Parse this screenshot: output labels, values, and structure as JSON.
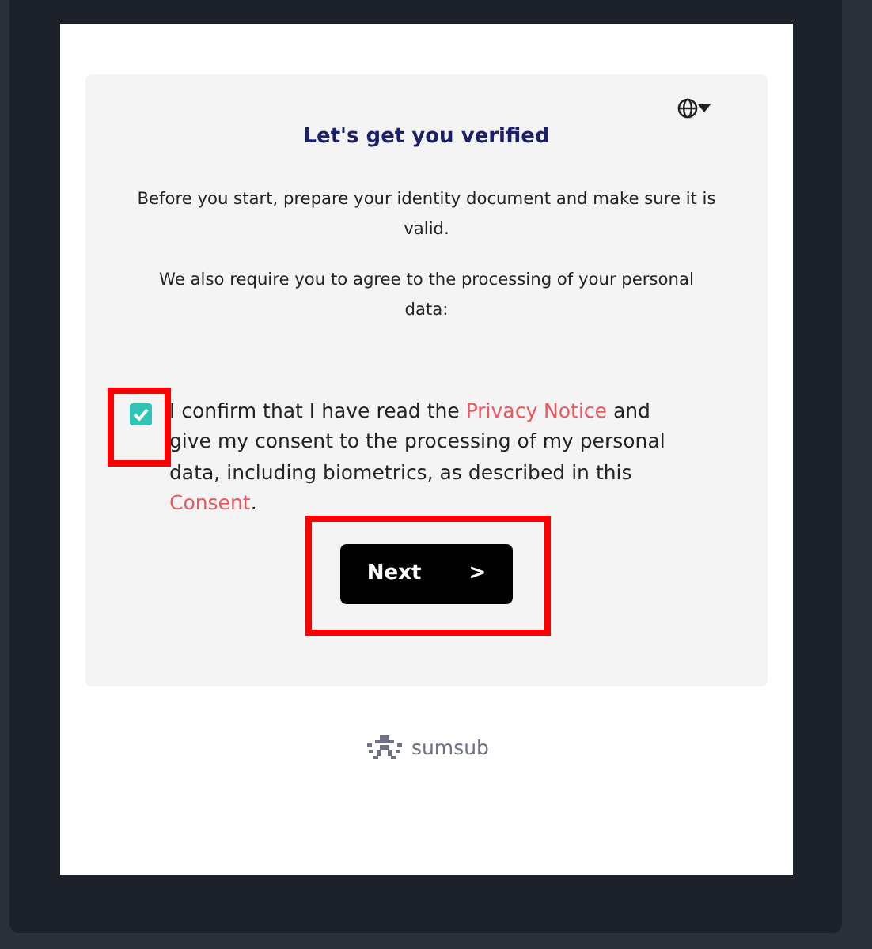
{
  "title": "Let's get you verified",
  "paragraphs": [
    "Before you start, prepare your identity document and make sure it is valid.",
    "We also require you to agree to the processing of your personal data:"
  ],
  "consent": {
    "checked": true,
    "highlighted": true,
    "parts": [
      {
        "text": "I confirm that I have read the ",
        "kind": "text"
      },
      {
        "text": "Privacy Notice",
        "kind": "link"
      },
      {
        "text": " and give my consent to the processing of my personal data, including biometrics, as described in this ",
        "kind": "text"
      },
      {
        "text": "Consent",
        "kind": "link"
      },
      {
        "text": ".",
        "kind": "text"
      }
    ]
  },
  "next_button": {
    "label": "Next",
    "chevron": ">",
    "highlighted": true
  },
  "brand": "sumsub"
}
